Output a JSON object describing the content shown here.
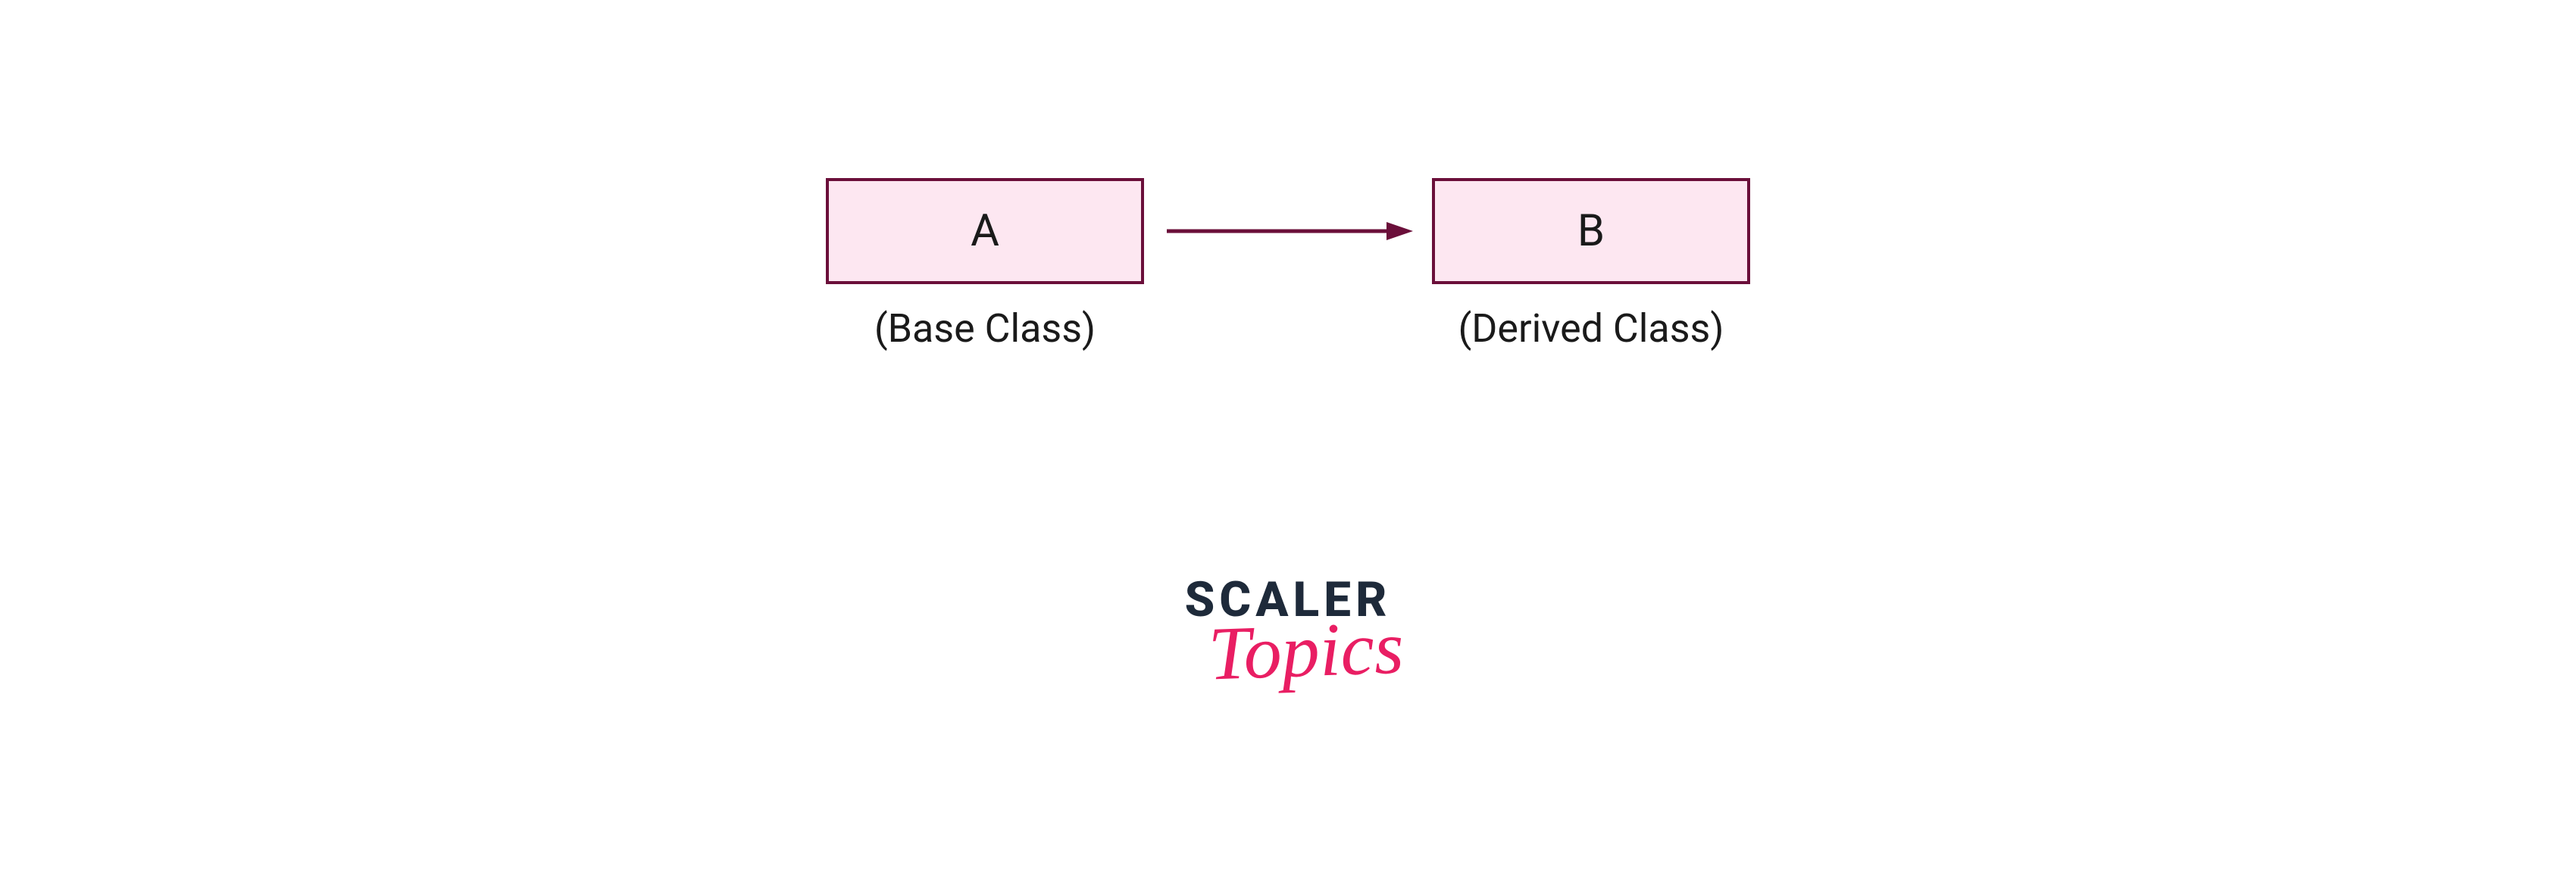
{
  "diagram": {
    "box_a": {
      "label": "A",
      "caption": "(Base Class)"
    },
    "box_b": {
      "label": "B",
      "caption": "(Derived Class)"
    },
    "arrow": {
      "color": "#6b0f3a",
      "direction": "right"
    },
    "colors": {
      "box_fill": "#fde7f1",
      "box_border": "#6b0f3a",
      "text": "#1a1a1a"
    }
  },
  "logo": {
    "line1": "SCALER",
    "line2": "Topics",
    "color_line1": "#1e2a3a",
    "color_line2": "#e91e63"
  }
}
